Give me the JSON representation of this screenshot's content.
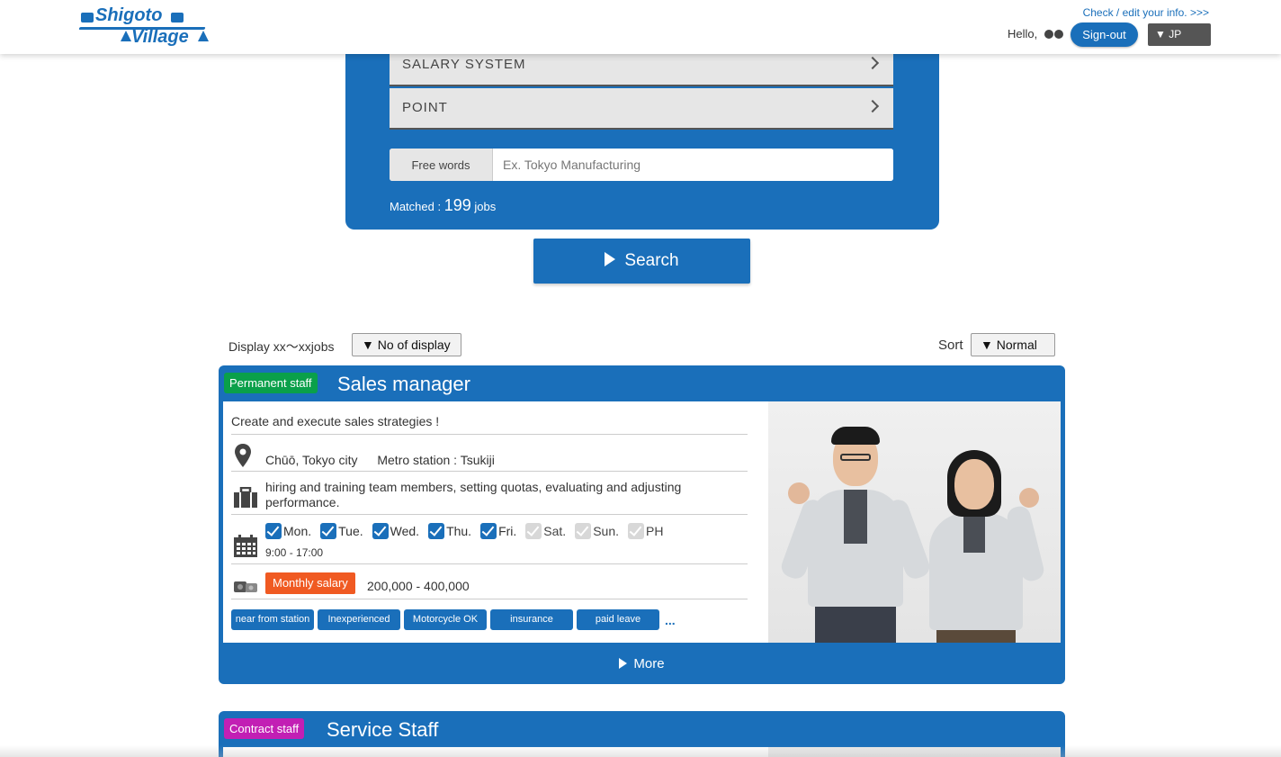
{
  "header": {
    "logo_line1": "Shigoto",
    "logo_line2": "Village",
    "check_link": "Check / edit your info. >>>",
    "hello": "Hello,",
    "signout_label": "Sign-out",
    "language": "▼ JP"
  },
  "search": {
    "rows": [
      {
        "label": "SALARY SYSTEM"
      },
      {
        "label": "POINT"
      }
    ],
    "free_words_label": "Free words",
    "free_words_value": "",
    "free_words_placeholder": "Ex. Tokyo Manufacturing",
    "matched_label": "Matched :",
    "matched_count": "199",
    "matched_unit": "jobs",
    "search_button": "Search"
  },
  "list": {
    "display_text": "Display xx〜xxjobs",
    "no_of_display": "▼ No of display",
    "sort_label": "Sort",
    "sort_value": "▼ Normal"
  },
  "jobs": [
    {
      "employment_type": "Permanent staff",
      "employment_color": "#0aa04a",
      "title": "Sales manager",
      "tagline": "Create and execute sales strategies !",
      "location": "Chūō, Tokyo city",
      "station": "Metro station : Tsukiji",
      "duties_line1": "hiring and training team members, setting quotas, evaluating and adjusting",
      "duties_line2": "performance.",
      "days": [
        {
          "label": "Mon.",
          "checked": true
        },
        {
          "label": "Tue.",
          "checked": true
        },
        {
          "label": "Wed.",
          "checked": true
        },
        {
          "label": "Thu.",
          "checked": true
        },
        {
          "label": "Fri.",
          "checked": true
        },
        {
          "label": "Sat.",
          "checked": false
        },
        {
          "label": "Sun.",
          "checked": false
        },
        {
          "label": "PH",
          "checked": false
        }
      ],
      "hours": "9:00 - 17:00",
      "salary_type": "Monthly salary",
      "salary_range": "200,000 - 400,000",
      "tags": [
        "near from station",
        "Inexperienced OK",
        "Motorcycle OK",
        "insurance",
        "paid leave"
      ],
      "tags_more": "...",
      "more_label": "More"
    },
    {
      "employment_type": "Contract staff",
      "employment_color": "#c21fb4",
      "title": "Service Staff"
    }
  ],
  "colors": {
    "primary": "#1a6fba",
    "salary_badge": "#f05a22"
  }
}
